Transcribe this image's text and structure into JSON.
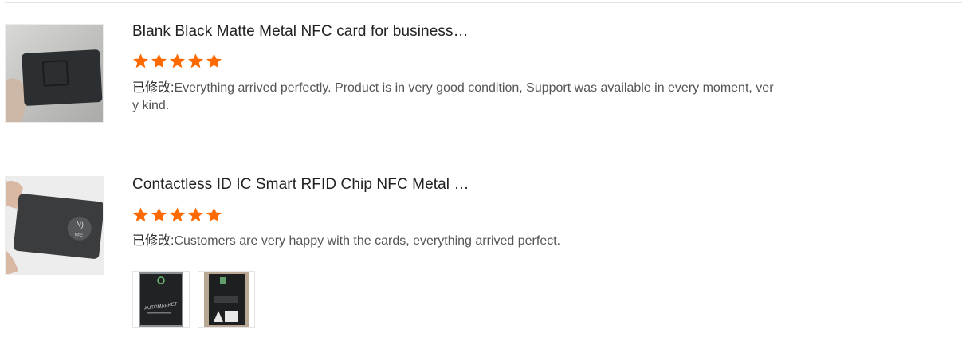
{
  "reviews": [
    {
      "title": "Blank Black Matte Metal NFC card for business…",
      "rating": 5,
      "rating_max": 5,
      "tag": "已修改:",
      "text": "Everything arrived perfectly. Product is in very good condition, Support was available in every moment, very kind.",
      "photos": []
    },
    {
      "title": "Contactless ID IC Smart RFID Chip NFC Metal …",
      "rating": 5,
      "rating_max": 5,
      "tag": "已修改:",
      "text": "Customers are very happy with the cards, everything arrived perfect.",
      "nfc_label": "NFC",
      "photos": [
        {
          "caption": "AUTOMARKET"
        },
        {
          "caption": ""
        }
      ]
    }
  ],
  "colors": {
    "star": "#ff6a00",
    "divider": "#e3e3e3"
  }
}
